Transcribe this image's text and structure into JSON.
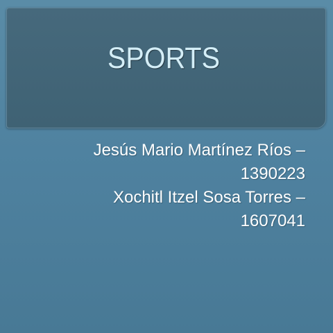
{
  "slide": {
    "title": "SPORTS",
    "authors": [
      {
        "name": "Jesús Mario Martínez Ríos –",
        "id": "1390223"
      },
      {
        "name": "Xochitl Itzel Sosa Torres –",
        "id": "1607041"
      }
    ]
  },
  "colors": {
    "background": "#5186a3",
    "title_box": "#426577",
    "title_text": "#d4eef7",
    "body_text": "#ffffff"
  }
}
